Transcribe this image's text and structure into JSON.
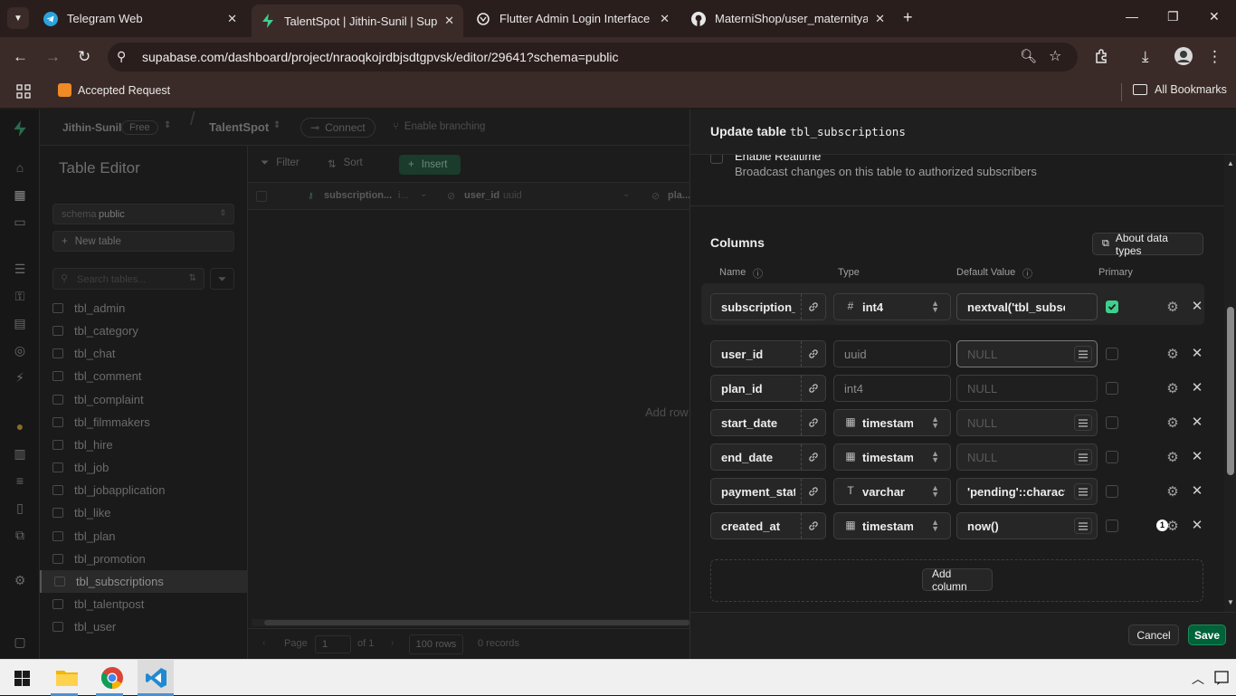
{
  "browser": {
    "tabs": [
      {
        "title": "Telegram Web",
        "icon": "telegram-icon",
        "active": false
      },
      {
        "title": "TalentSpot | Jithin-Sunil | Supabase",
        "icon": "supabase-icon",
        "active": true
      },
      {
        "title": "Flutter Admin Login Interface - ",
        "icon": "chatgpt-icon",
        "active": false
      },
      {
        "title": "MaterniShop/user_maternityapp",
        "icon": "github-icon",
        "active": false
      }
    ],
    "url": "supabase.com/dashboard/project/nraoqkojrdbjsdtgpvsk/editor/29641?schema=public",
    "bookmark": "Accepted Request",
    "all_bookmarks": "All Bookmarks"
  },
  "project": {
    "org": "Jithin-Sunil",
    "plan": "Free",
    "name": "TalentSpot",
    "connect": "Connect",
    "branching": "Enable branching"
  },
  "sidebar": {
    "title": "Table Editor",
    "schema_label": "schema",
    "schema_value": "public",
    "new_table": "New table",
    "search_placeholder": "Search tables...",
    "tables": [
      "tbl_admin",
      "tbl_category",
      "tbl_chat",
      "tbl_comment",
      "tbl_complaint",
      "tbl_filmmakers",
      "tbl_hire",
      "tbl_job",
      "tbl_jobapplication",
      "tbl_like",
      "tbl_plan",
      "tbl_promotion",
      "tbl_subscriptions",
      "tbl_talentpost",
      "tbl_user"
    ],
    "selected": "tbl_subscriptions"
  },
  "grid": {
    "filter": "Filter",
    "sort": "Sort",
    "insert": "Insert",
    "col1": "subscription...",
    "col1_type": "i...",
    "col2": "user_id",
    "col2_type": "uuid",
    "col3": "pla...",
    "empty": "Add row",
    "page_label": "Page",
    "page_value": "1",
    "of": "of 1",
    "rows": "100 rows",
    "records": "0 records"
  },
  "panel": {
    "title_prefix": "Update table",
    "table_name": "tbl_subscriptions",
    "realtime_title": "Enable Realtime",
    "realtime_desc": "Broadcast changes on this table to authorized subscribers",
    "columns_heading": "Columns",
    "about_types": "About data types",
    "headers": {
      "name": "Name",
      "type": "Type",
      "default": "Default Value",
      "primary": "Primary"
    },
    "columns": [
      {
        "name": "subscription_id",
        "type": "int4",
        "type_icon": "hash-icon",
        "default": "nextval('tbl_subscr",
        "primary": true,
        "editable_type": true
      },
      {
        "name": "user_id",
        "type": "uuid",
        "type_icon": "",
        "default": "NULL",
        "primary": false,
        "editable_type": false
      },
      {
        "name": "plan_id",
        "type": "int4",
        "type_icon": "",
        "default": "NULL",
        "primary": false,
        "editable_type": false
      },
      {
        "name": "start_date",
        "type": "timestamp",
        "type_icon": "calendar-icon",
        "default": "NULL",
        "primary": false,
        "editable_type": true
      },
      {
        "name": "end_date",
        "type": "timestamp",
        "type_icon": "calendar-icon",
        "default": "NULL",
        "primary": false,
        "editable_type": true
      },
      {
        "name": "payment_status",
        "type": "varchar",
        "type_icon": "text-type-icon",
        "default": "'pending'::character",
        "primary": false,
        "editable_type": true
      },
      {
        "name": "created_at",
        "type": "timestamp",
        "type_icon": "calendar-icon",
        "default": "now()",
        "primary": false,
        "editable_type": true
      }
    ],
    "badge": "1",
    "add_column": "Add column",
    "cancel": "Cancel",
    "save": "Save"
  },
  "colors": {
    "accent": "#3ecf8e",
    "save_bg": "#006239",
    "chrome_bg": "#3b2b28"
  }
}
